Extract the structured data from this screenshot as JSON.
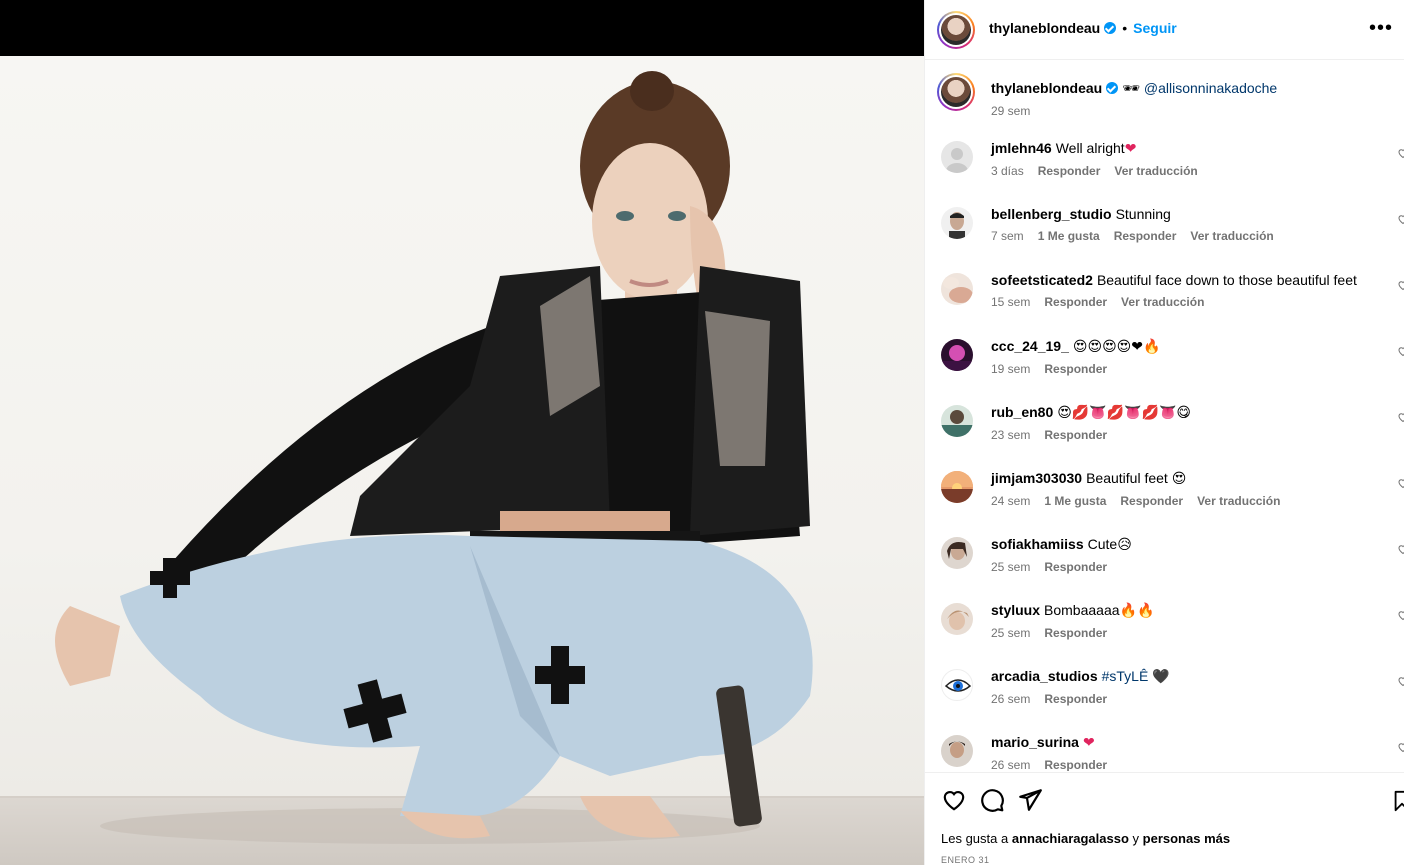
{
  "post": {
    "author": "thylaneblondeau",
    "follow_label": "Seguir",
    "separator": "•",
    "more_label": "•••"
  },
  "caption": {
    "username": "thylaneblondeau",
    "glasses": "🕶",
    "mention": "@allisonninakadoche",
    "time": "29 sem"
  },
  "comments": [
    {
      "user": "jmlehn46",
      "text": "Well alright",
      "emoji": "❤",
      "time": "3 días",
      "likes": "",
      "reply": "Responder",
      "translate": "Ver traducción",
      "avatar": "#e0e0e0"
    },
    {
      "user": "bellenberg_studio",
      "text": "Stunning",
      "emoji": "",
      "time": "7 sem",
      "likes": "1 Me gusta",
      "reply": "Responder",
      "translate": "Ver traducción",
      "avatar": "#b8b8b8"
    },
    {
      "user": "sofeetsticated2",
      "text": "Beautiful face down to those beautiful feet",
      "emoji": "",
      "time": "15 sem",
      "likes": "",
      "reply": "Responder",
      "translate": "Ver traducción",
      "avatar": "#d9b8a8"
    },
    {
      "user": "ccc_24_19_",
      "text": "",
      "emoji": "😍😍😍😍❤🔥",
      "time": "19 sem",
      "likes": "",
      "reply": "Responder",
      "translate": "",
      "avatar": "#7a1f6a"
    },
    {
      "user": "rub_en80",
      "text": "",
      "emoji": "😍💋👅💋👅💋👅😋",
      "time": "23 sem",
      "likes": "",
      "reply": "Responder",
      "translate": "",
      "avatar": "#4f7a72"
    },
    {
      "user": "jimjam303030",
      "text": "Beautiful feet",
      "emoji": "😍",
      "time": "24 sem",
      "likes": "1 Me gusta",
      "reply": "Responder",
      "translate": "Ver traducción",
      "avatar": "#b86a4a"
    },
    {
      "user": "sofiakhamiiss",
      "text": "Cute",
      "emoji": "😥",
      "time": "25 sem",
      "likes": "",
      "reply": "Responder",
      "translate": "",
      "avatar": "#a79a90"
    },
    {
      "user": "styluux",
      "text": "Bombaaaaa",
      "emoji": "🔥🔥",
      "time": "25 sem",
      "likes": "",
      "reply": "Responder",
      "translate": "",
      "avatar": "#c9b6a4"
    },
    {
      "user": "arcadia_studios",
      "text": "",
      "hashtag": "#sTyLÊ",
      "emoji": "🖤",
      "time": "26 sem",
      "likes": "",
      "reply": "Responder",
      "translate": "",
      "avatar": "#ffffff"
    },
    {
      "user": "mario_surina",
      "text": "",
      "emoji": "❤",
      "time": "26 sem",
      "likes": "",
      "reply": "Responder",
      "translate": "",
      "avatar": "#9a8d84"
    }
  ],
  "footer": {
    "likes_prefix": "Les gusta a",
    "likes_user": "annachiaragalasso",
    "likes_conj": "y",
    "likes_others": "personas más",
    "date": "ENERO 31"
  },
  "colors": {
    "accent": "#0095f6",
    "mention": "#00376b",
    "muted": "#737373"
  }
}
